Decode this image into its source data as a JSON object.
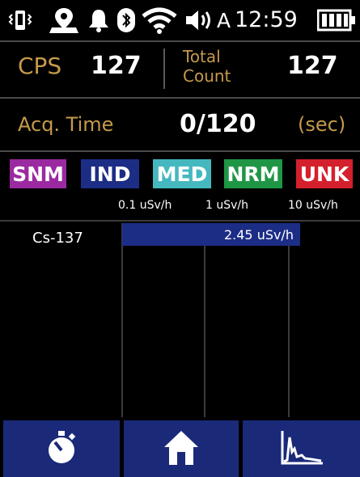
{
  "status_bar": {
    "time": "12:59",
    "mode_letter": "A",
    "icons": [
      "vibrate-icon",
      "location-icon",
      "bell-icon",
      "bluetooth-icon",
      "wifi-icon",
      "volume-icon",
      "battery-icon"
    ]
  },
  "counts": {
    "cps_label": "CPS",
    "cps_value": "127",
    "total_label_line1": "Total",
    "total_label_line2": "Count",
    "total_value": "127"
  },
  "acquisition": {
    "label": "Acq. Time",
    "value": "0/120",
    "unit": "(sec)"
  },
  "categories": [
    {
      "label": "SNM",
      "color": "#9b2aa0"
    },
    {
      "label": "IND",
      "color": "#1c2d86"
    },
    {
      "label": "MED",
      "color": "#45b8bf"
    },
    {
      "label": "NRM",
      "color": "#1e9645"
    },
    {
      "label": "UNK",
      "color": "#d4202c"
    }
  ],
  "scale": {
    "ticks": [
      "0.1 uSv/h",
      "1 uSv/h",
      "10 uSv/h"
    ]
  },
  "isotopes": [
    {
      "name": "Cs-137",
      "dose_label": "2.45 uSv/h",
      "dose_value": 2.45
    }
  ],
  "nav": {
    "buttons": [
      "timer-icon",
      "home-icon",
      "spectrum-icon"
    ]
  },
  "colors": {
    "accent_gold": "#c59a4a",
    "nav_bg": "#1a2a78",
    "bar_blue": "#1c2d86"
  }
}
